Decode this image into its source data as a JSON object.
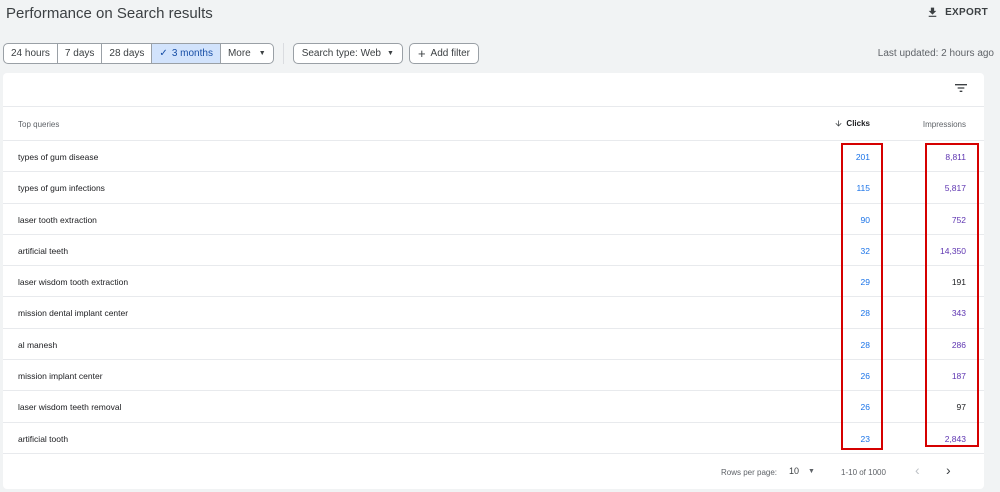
{
  "header": {
    "title": "Performance on Search results",
    "export_label": "EXPORT"
  },
  "toolbar": {
    "date_ranges": [
      "24 hours",
      "7 days",
      "28 days",
      "3 months"
    ],
    "selected": "3 months",
    "more_label": "More",
    "search_type_label": "Search type: Web",
    "add_filter_label": "Add filter",
    "last_updated": "Last updated: 2 hours ago"
  },
  "table": {
    "headers": {
      "query": "Top queries",
      "clicks": "Clicks",
      "impressions": "Impressions"
    },
    "rows": [
      {
        "query": "types of gum disease",
        "clicks": "201",
        "impressions": "8,811"
      },
      {
        "query": "types of gum infections",
        "clicks": "115",
        "impressions": "5,817"
      },
      {
        "query": "laser tooth extraction",
        "clicks": "90",
        "impressions": "752"
      },
      {
        "query": "artificial teeth",
        "clicks": "32",
        "impressions": "14,350"
      },
      {
        "query": "laser wisdom tooth extraction",
        "clicks": "29",
        "impressions": "191"
      },
      {
        "query": "mission dental implant center",
        "clicks": "28",
        "impressions": "343"
      },
      {
        "query": "al manesh",
        "clicks": "28",
        "impressions": "286"
      },
      {
        "query": "mission implant center",
        "clicks": "26",
        "impressions": "187"
      },
      {
        "query": "laser wisdom teeth removal",
        "clicks": "26",
        "impressions": "97"
      },
      {
        "query": "artificial tooth",
        "clicks": "23",
        "impressions": "2,843"
      }
    ]
  },
  "pagination": {
    "rows_per_page_label": "Rows per page:",
    "rows_per_page": "10",
    "range": "1-10 of 1000"
  },
  "colors": {
    "clicks": "#1a73e8",
    "impressions": "#5e35b1",
    "highlight": "#d50000",
    "selected_bg": "#d2e3fc"
  }
}
